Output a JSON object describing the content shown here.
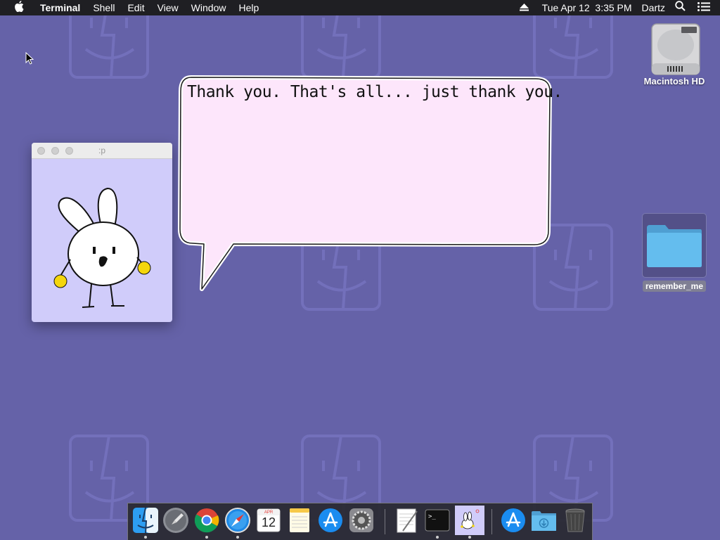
{
  "menubar": {
    "apple_icon": "apple-icon",
    "app_name": "Terminal",
    "menus": [
      "Shell",
      "Edit",
      "View",
      "Window",
      "Help"
    ],
    "eject_icon": "eject-icon",
    "datetime": "Tue Apr 12  3:35 PM",
    "user": "Dartz",
    "search_icon": "search-icon",
    "list_icon": "notification-list-icon"
  },
  "desktop": {
    "hd_label": "Macintosh HD",
    "folder_label": "remember_me"
  },
  "pet_window": {
    "title": ":p"
  },
  "bubble": {
    "text": "Thank you. That's all... just thank you."
  },
  "dock": {
    "calendar_month": "APR",
    "calendar_day": "12",
    "terminal_prompt": ">_"
  },
  "colors": {
    "desktop": "#6562a8",
    "bubble_fill": "#fde6fb",
    "pet_bg": "#d0ccfa",
    "folder": "#5fb4e5"
  }
}
